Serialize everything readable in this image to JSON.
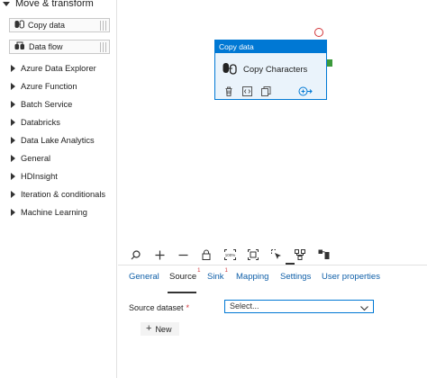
{
  "left_panel": {
    "open_category": "Move & transform",
    "activities": [
      {
        "label": "Copy data",
        "icon": "copy-data-icon"
      },
      {
        "label": "Data flow",
        "icon": "data-flow-icon"
      }
    ],
    "categories": [
      "Azure Data Explorer",
      "Azure Function",
      "Batch Service",
      "Databricks",
      "Data Lake Analytics",
      "General",
      "HDInsight",
      "Iteration & conditionals",
      "Machine Learning"
    ]
  },
  "canvas": {
    "node": {
      "type_label": "Copy data",
      "name": "Copy Characters",
      "accent": "#0078d4",
      "error_color": "#d13438",
      "success_color": "#3c9a3c"
    }
  },
  "toolbar": {
    "icons": [
      "search-icon",
      "zoom-in-icon",
      "zoom-out-icon",
      "lock-icon",
      "zoom-100-icon",
      "fit-to-screen-icon",
      "select-icon",
      "auto-align-icon",
      "layout-icon"
    ],
    "zoom_label": "100%"
  },
  "properties": {
    "tabs": [
      {
        "label": "General",
        "error_count": ""
      },
      {
        "label": "Source",
        "error_count": "1"
      },
      {
        "label": "Sink",
        "error_count": "1"
      },
      {
        "label": "Mapping",
        "error_count": ""
      },
      {
        "label": "Settings",
        "error_count": ""
      },
      {
        "label": "User properties",
        "error_count": ""
      }
    ],
    "active_tab": "Source",
    "source_dataset": {
      "label": "Source dataset",
      "required_mark": "*",
      "value": "Select..."
    },
    "new_button": "New"
  }
}
